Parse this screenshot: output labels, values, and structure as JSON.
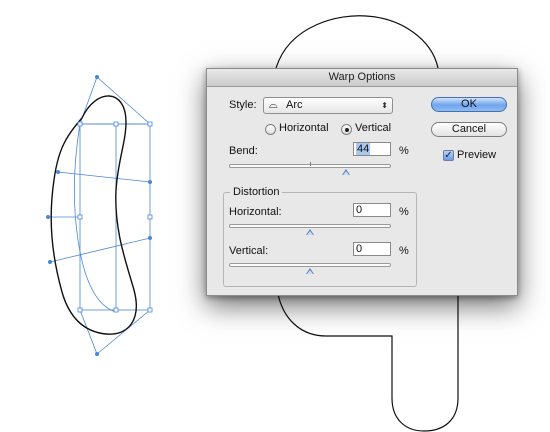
{
  "dialog": {
    "title": "Warp Options",
    "style": {
      "label": "Style:",
      "value": "Arc",
      "icon": "arc-warp-icon"
    },
    "orientation": {
      "options": [
        "Horizontal",
        "Vertical"
      ],
      "selected": "Vertical"
    },
    "bend": {
      "label": "Bend:",
      "value": "44",
      "unit": "%",
      "fraction": 0.72
    },
    "distortion": {
      "title": "Distortion",
      "horizontal": {
        "label": "Horizontal:",
        "value": "0",
        "unit": "%",
        "fraction": 0.5
      },
      "vertical": {
        "label": "Vertical:",
        "value": "0",
        "unit": "%",
        "fraction": 0.5
      }
    },
    "buttons": {
      "ok": "OK",
      "cancel": "Cancel"
    },
    "preview": {
      "label": "Preview",
      "checked": true
    }
  },
  "colors": {
    "selection_blue": "#4a86d8",
    "artwork_stroke": "#111111",
    "dialog_bg": "#e8e8e8",
    "default_button": "#6ea4ec"
  }
}
